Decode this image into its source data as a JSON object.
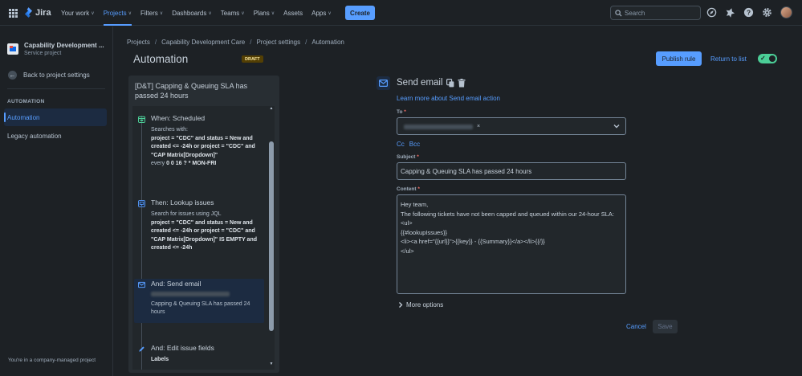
{
  "topnav": {
    "logo": "Jira",
    "items": [
      {
        "label": "Your work",
        "chevron": true
      },
      {
        "label": "Projects",
        "chevron": true,
        "active": true
      },
      {
        "label": "Filters",
        "chevron": true
      },
      {
        "label": "Dashboards",
        "chevron": true
      },
      {
        "label": "Teams",
        "chevron": true
      },
      {
        "label": "Plans",
        "chevron": true
      },
      {
        "label": "Assets",
        "chevron": false
      },
      {
        "label": "Apps",
        "chevron": true
      }
    ],
    "create_label": "Create",
    "search_placeholder": "Search",
    "icons": [
      "compass-icon",
      "notification-icon",
      "help-icon",
      "settings-icon"
    ]
  },
  "sidebar": {
    "project_name": "Capability Development ...",
    "project_type": "Service project",
    "back_label": "Back to project settings",
    "section_label": "AUTOMATION",
    "items": [
      {
        "label": "Automation",
        "active": true
      },
      {
        "label": "Legacy automation",
        "active": false
      }
    ],
    "footer": "You're in a company-managed project"
  },
  "breadcrumb": [
    "Projects",
    "Capability Development Care",
    "Project settings",
    "Automation"
  ],
  "header": {
    "title": "Automation",
    "badge": "DRAFT",
    "publish_label": "Publish rule",
    "return_label": "Return to list",
    "enabled": true
  },
  "rule": {
    "title": "[D&T] Capping & Queuing SLA has passed 24 hours",
    "steps": [
      {
        "title": "When: Scheduled",
        "icon": "calendar-icon",
        "color": "#4bce97",
        "intro": "Searches with:",
        "query": "project = \"CDC\" and status = New and created <= -24h or project = \"CDC\" and \"CAP Matrix[Dropdown]\"",
        "cron_prefix": "every",
        "cron": "0 0 16 ? * MON-FRI"
      },
      {
        "title": "Then: Lookup issues",
        "icon": "lookup-icon",
        "color": "#579dff",
        "intro": "Search for issues using JQL",
        "query": "project = \"CDC\" and status = New and created <= -24h or project = \"CDC\" and \"CAP Matrix[Dropdown]\" IS EMPTY and created <= -24h"
      },
      {
        "title": "And: Send email",
        "icon": "email-icon",
        "color": "#579dff",
        "subject": "Capping & Queuing SLA has passed 24 hours"
      },
      {
        "title": "And: Edit issue fields",
        "icon": "edit-icon",
        "color": "#579dff",
        "field": "Labels"
      }
    ]
  },
  "email_form": {
    "title": "Send email",
    "learn_link": "Learn more about Send email action",
    "to_label": "To",
    "cc_label": "Cc",
    "bcc_label": "Bcc",
    "subject_label": "Subject",
    "subject_value": "Capping & Queuing SLA has passed 24 hours",
    "content_label": "Content",
    "content_value": "Hey team,\nThe following tickets have not been capped and queued within our 24-hour SLA:\n<ul>\n{{#lookupIssues}}\n<li><a href=\"{{url}}\">{{key}} - {{Summary}}</a></li>{{/}}\n</ul>",
    "more_options": "More options",
    "cancel_label": "Cancel",
    "save_label": "Save"
  }
}
